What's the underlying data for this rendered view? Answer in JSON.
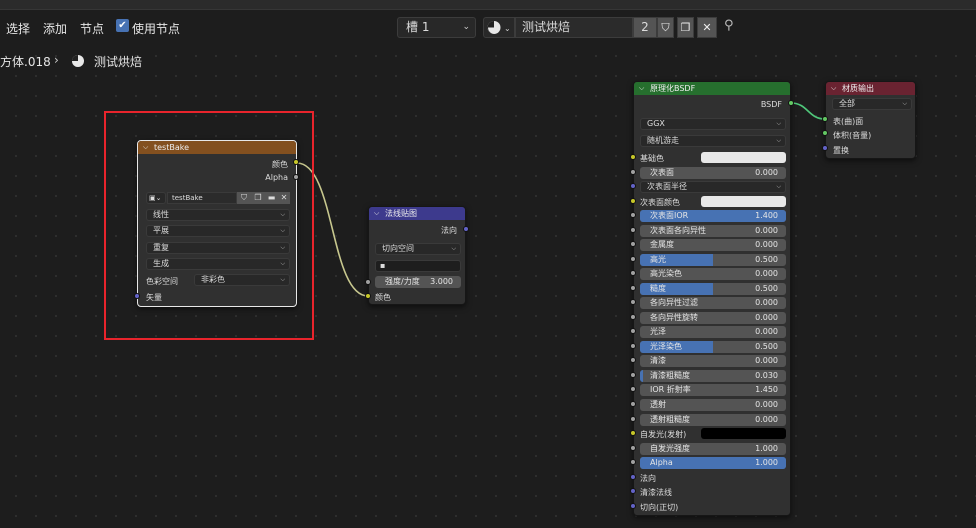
{
  "header": {
    "menu": [
      "选择",
      "添加",
      "节点"
    ],
    "use_nodes_label": "使用节点",
    "use_nodes_checked": true,
    "slot": "槽 1",
    "material_name": "测试烘焙",
    "user_count": "2",
    "breadcrumb": {
      "object": "方体.018",
      "material": "测试烘焙"
    }
  },
  "colors": {
    "image_header": "#83501f",
    "normalmap_header": "#3d3a8d",
    "bsdf_header": "#266f2e",
    "output_header": "#6a2331",
    "highlight": "#e8242c",
    "accent": "#4772b3"
  },
  "image_node": {
    "title": "testBake",
    "outputs": [
      "颜色",
      "Alpha"
    ],
    "image_name": "testBake",
    "interpolation": "线性",
    "projection": "平展",
    "extension": "重复",
    "source": "生成",
    "colorspace_label": "色彩空间",
    "colorspace": "非彩色",
    "input_vector": "矢量"
  },
  "normal_node": {
    "title": "法线贴图",
    "output": "法向",
    "space": "切向空间",
    "uvmap": "",
    "strength_label": "强度/力度",
    "strength": "3.000",
    "input_color": "颜色"
  },
  "bsdf_node": {
    "title": "原理化BSDF",
    "output": "BSDF",
    "distribution": "GGX",
    "subsurface_method": "随机游走",
    "rows": [
      {
        "type": "color",
        "label": "基础色",
        "socket": "y",
        "swatch": "#e8e8e8"
      },
      {
        "type": "field",
        "label": "次表面",
        "value": "0.000",
        "fill": 0,
        "socket": "g"
      },
      {
        "type": "vector",
        "label": "次表面半径",
        "socket": "p"
      },
      {
        "type": "color",
        "label": "次表面颜色",
        "socket": "y",
        "swatch": "#e8e8e8"
      },
      {
        "type": "field",
        "label": "次表面IOR",
        "value": "1.400",
        "fill": 1,
        "socket": "g"
      },
      {
        "type": "field",
        "label": "次表面各向异性",
        "value": "0.000",
        "fill": 0,
        "socket": "g"
      },
      {
        "type": "field",
        "label": "金属度",
        "value": "0.000",
        "fill": 0,
        "socket": "g"
      },
      {
        "type": "field",
        "label": "高光",
        "value": "0.500",
        "fill": 0.5,
        "socket": "g"
      },
      {
        "type": "field",
        "label": "高光染色",
        "value": "0.000",
        "fill": 0,
        "socket": "g"
      },
      {
        "type": "field",
        "label": "糙度",
        "value": "0.500",
        "fill": 0.5,
        "socket": "g"
      },
      {
        "type": "field",
        "label": "各向异性过滤",
        "value": "0.000",
        "fill": 0,
        "socket": "g"
      },
      {
        "type": "field",
        "label": "各向异性旋转",
        "value": "0.000",
        "fill": 0,
        "socket": "g"
      },
      {
        "type": "field",
        "label": "光泽",
        "value": "0.000",
        "fill": 0,
        "socket": "g"
      },
      {
        "type": "field",
        "label": "光泽染色",
        "value": "0.500",
        "fill": 0.5,
        "socket": "g"
      },
      {
        "type": "field",
        "label": "清漆",
        "value": "0.000",
        "fill": 0,
        "socket": "g"
      },
      {
        "type": "field",
        "label": "清漆粗糙度",
        "value": "0.030",
        "fill": 0.03,
        "socket": "g"
      },
      {
        "type": "field",
        "label": "IOR 折射率",
        "value": "1.450",
        "fill": 0,
        "socket": "g"
      },
      {
        "type": "field",
        "label": "透射",
        "value": "0.000",
        "fill": 0,
        "socket": "g"
      },
      {
        "type": "field",
        "label": "透射粗糙度",
        "value": "0.000",
        "fill": 0,
        "socket": "g"
      },
      {
        "type": "color",
        "label": "自发光(发射)",
        "socket": "y",
        "swatch": "#000000"
      },
      {
        "type": "field",
        "label": "自发光强度",
        "value": "1.000",
        "fill": 0,
        "socket": "g"
      },
      {
        "type": "field",
        "label": "Alpha",
        "value": "1.000",
        "fill": 1,
        "socket": "g"
      },
      {
        "type": "vector",
        "label": "法向",
        "socket": "p"
      },
      {
        "type": "vector",
        "label": "清漆法线",
        "socket": "p"
      },
      {
        "type": "vector",
        "label": "切向(正切)",
        "socket": "p"
      }
    ]
  },
  "output_node": {
    "title": "材质输出",
    "target": "全部",
    "inputs": [
      "表(曲)面",
      "体积(音量)",
      "置换"
    ]
  }
}
